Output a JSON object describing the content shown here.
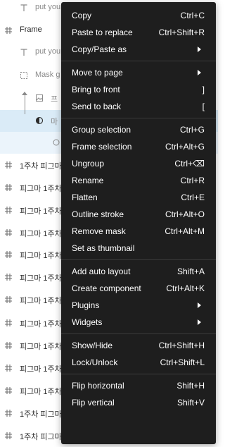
{
  "layers": [
    {
      "label": "put you",
      "icon": "text-icon",
      "style": "dim"
    },
    {
      "label": "Frame",
      "icon": "frame-hash-icon",
      "style": "bold"
    },
    {
      "label": "put you",
      "icon": "text-icon",
      "style": "dim"
    },
    {
      "label": "Mask g",
      "icon": "mask-dashed-icon",
      "style": "dim"
    },
    {
      "label": "프",
      "icon": "image-icon",
      "style": "dim"
    },
    {
      "label": "마",
      "icon": "half-circle-icon",
      "style": "dim"
    },
    {
      "label": "",
      "icon": "ellipse-icon",
      "style": "dim"
    },
    {
      "label": "1주차 피그마",
      "icon": "frame-hash-icon",
      "style": "normal"
    },
    {
      "label": "피그마 1주차",
      "icon": "frame-hash-icon",
      "style": "normal"
    },
    {
      "label": "피그마 1주차",
      "icon": "frame-hash-icon",
      "style": "normal"
    },
    {
      "label": "피그마 1주차",
      "icon": "frame-hash-icon",
      "style": "normal"
    },
    {
      "label": "피그마 1주차",
      "icon": "frame-hash-icon",
      "style": "normal"
    },
    {
      "label": "피그마 1주차",
      "icon": "frame-hash-icon",
      "style": "normal"
    },
    {
      "label": "피그마 1주차",
      "icon": "frame-hash-icon",
      "style": "normal"
    },
    {
      "label": "피그마 1주차",
      "icon": "frame-hash-icon",
      "style": "normal"
    },
    {
      "label": "피그마 1주차",
      "icon": "frame-hash-icon",
      "style": "normal"
    },
    {
      "label": "피그마 1주차",
      "icon": "frame-hash-icon",
      "style": "normal"
    },
    {
      "label": "피그마 1주차",
      "icon": "frame-hash-icon",
      "style": "normal"
    },
    {
      "label": "1주차 피그마",
      "icon": "frame-hash-icon",
      "style": "normal"
    },
    {
      "label": "1주차 피그마",
      "icon": "frame-hash-icon",
      "style": "normal"
    }
  ],
  "menu": {
    "groups": [
      [
        {
          "label": "Copy",
          "shortcut": "Ctrl+C"
        },
        {
          "label": "Paste to replace",
          "shortcut": "Ctrl+Shift+R"
        },
        {
          "label": "Copy/Paste as",
          "submenu": true
        }
      ],
      [
        {
          "label": "Move to page",
          "submenu": true
        },
        {
          "label": "Bring to front",
          "shortcut": "]"
        },
        {
          "label": "Send to back",
          "shortcut": "["
        }
      ],
      [
        {
          "label": "Group selection",
          "shortcut": "Ctrl+G"
        },
        {
          "label": "Frame selection",
          "shortcut": "Ctrl+Alt+G"
        },
        {
          "label": "Ungroup",
          "shortcut": "Ctrl+⌫"
        },
        {
          "label": "Rename",
          "shortcut": "Ctrl+R"
        },
        {
          "label": "Flatten",
          "shortcut": "Ctrl+E"
        },
        {
          "label": "Outline stroke",
          "shortcut": "Ctrl+Alt+O"
        },
        {
          "label": "Remove mask",
          "shortcut": "Ctrl+Alt+M"
        },
        {
          "label": "Set as thumbnail"
        }
      ],
      [
        {
          "label": "Add auto layout",
          "shortcut": "Shift+A"
        },
        {
          "label": "Create component",
          "shortcut": "Ctrl+Alt+K"
        },
        {
          "label": "Plugins",
          "submenu": true
        },
        {
          "label": "Widgets",
          "submenu": true
        }
      ],
      [
        {
          "label": "Show/Hide",
          "shortcut": "Ctrl+Shift+H"
        },
        {
          "label": "Lock/Unlock",
          "shortcut": "Ctrl+Shift+L"
        }
      ],
      [
        {
          "label": "Flip horizontal",
          "shortcut": "Shift+H"
        },
        {
          "label": "Flip vertical",
          "shortcut": "Shift+V"
        }
      ]
    ]
  },
  "colors": {
    "menu_bg": "#1e1e1e",
    "menu_text": "#ffffff",
    "selected_row": "#daebf7",
    "separator": "#3b3b3b"
  }
}
